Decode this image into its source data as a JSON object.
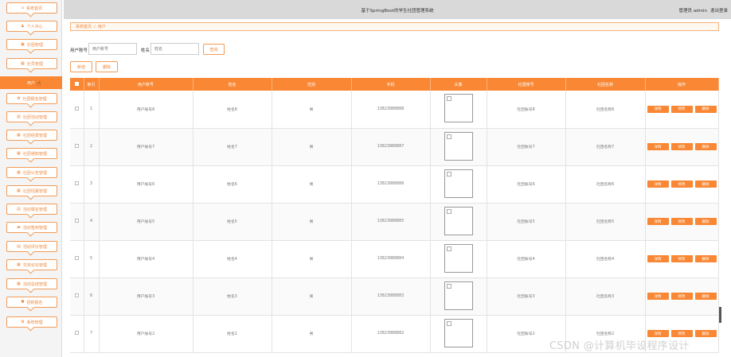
{
  "header": {
    "title": "基于SpringBoot的学生社团管理系统",
    "user": "管理员 admin",
    "logout": "退出登录"
  },
  "sidebar": {
    "items": [
      {
        "label": "系统首页",
        "icon": "home-icon",
        "glyph": "⌂"
      },
      {
        "label": "个人中心",
        "icon": "user-icon",
        "glyph": "♟"
      },
      {
        "label": "社团管理",
        "icon": "lock-icon",
        "glyph": "▣"
      },
      {
        "label": "社员管理",
        "icon": "grid-icon",
        "glyph": "▦"
      },
      {
        "label": "用户",
        "icon": "",
        "glyph": ""
      },
      {
        "label": "社团报名管理",
        "icon": "settings-icon",
        "glyph": "✿"
      },
      {
        "label": "社团活动管理",
        "icon": "bar-chart-icon",
        "glyph": "▥"
      },
      {
        "label": "社团经费管理",
        "icon": "grid-icon",
        "glyph": "▦"
      },
      {
        "label": "社团通知管理",
        "icon": "grid-icon",
        "glyph": "▦"
      },
      {
        "label": "社团公告管理",
        "icon": "grid-icon",
        "glyph": "▦"
      },
      {
        "label": "社团招募管理",
        "icon": "grid-icon",
        "glyph": "▦"
      },
      {
        "label": "活动报名管理",
        "icon": "folder-icon",
        "glyph": "▤"
      },
      {
        "label": "活动签到管理",
        "icon": "comment-icon",
        "glyph": "▬"
      },
      {
        "label": "活动评价管理",
        "icon": "list-icon",
        "glyph": "▤"
      },
      {
        "label": "交流论坛管理",
        "icon": "grid-icon",
        "glyph": "▦"
      },
      {
        "label": "活动总结管理",
        "icon": "grid-icon",
        "glyph": "▦"
      },
      {
        "label": "招新报名",
        "icon": "shield-icon",
        "glyph": "⛊"
      },
      {
        "label": "系统管理",
        "icon": "settings-icon",
        "glyph": "✿"
      }
    ],
    "active_index": 4
  },
  "breadcrumb": {
    "home": "系统首页",
    "sep": "/",
    "current": "用户"
  },
  "search": {
    "account_label": "用户账号",
    "account_placeholder": "用户账号",
    "name_label": "姓名",
    "name_placeholder": "姓名",
    "query_button": "查询"
  },
  "actions": {
    "add": "新增",
    "delete": "删除"
  },
  "table": {
    "columns": [
      "",
      "索引",
      "用户账号",
      "姓名",
      "性别",
      "手机",
      "头像",
      "社团账号",
      "社团名称",
      "操作"
    ],
    "buttons": {
      "detail": "详情",
      "edit": "修改",
      "delete": "删除"
    },
    "rows": [
      {
        "index": "1",
        "account": "用户账号8",
        "name": "姓名8",
        "gender": "男",
        "phone": "13823888888",
        "club_account": "社团账号8",
        "club_name": "社团名称8"
      },
      {
        "index": "2",
        "account": "用户账号7",
        "name": "姓名7",
        "gender": "男",
        "phone": "13823888887",
        "club_account": "社团账号7",
        "club_name": "社团名称7"
      },
      {
        "index": "3",
        "account": "用户账号6",
        "name": "姓名6",
        "gender": "男",
        "phone": "13823888886",
        "club_account": "社团账号6",
        "club_name": "社团名称6"
      },
      {
        "index": "4",
        "account": "用户账号5",
        "name": "姓名5",
        "gender": "男",
        "phone": "13823888885",
        "club_account": "社团账号5",
        "club_name": "社团名称5"
      },
      {
        "index": "5",
        "account": "用户账号4",
        "name": "姓名4",
        "gender": "男",
        "phone": "13823888884",
        "club_account": "社团账号4",
        "club_name": "社团名称4"
      },
      {
        "index": "6",
        "account": "用户账号3",
        "name": "姓名3",
        "gender": "男",
        "phone": "13823888883",
        "club_account": "社团账号3",
        "club_name": "社团名称3"
      },
      {
        "index": "7",
        "account": "用户账号2",
        "name": "姓名2",
        "gender": "男",
        "phone": "13823888882",
        "club_account": "社团账号2",
        "club_name": "社团名称2"
      }
    ]
  },
  "watermark": "CSDN @计算机毕设程序设计"
}
